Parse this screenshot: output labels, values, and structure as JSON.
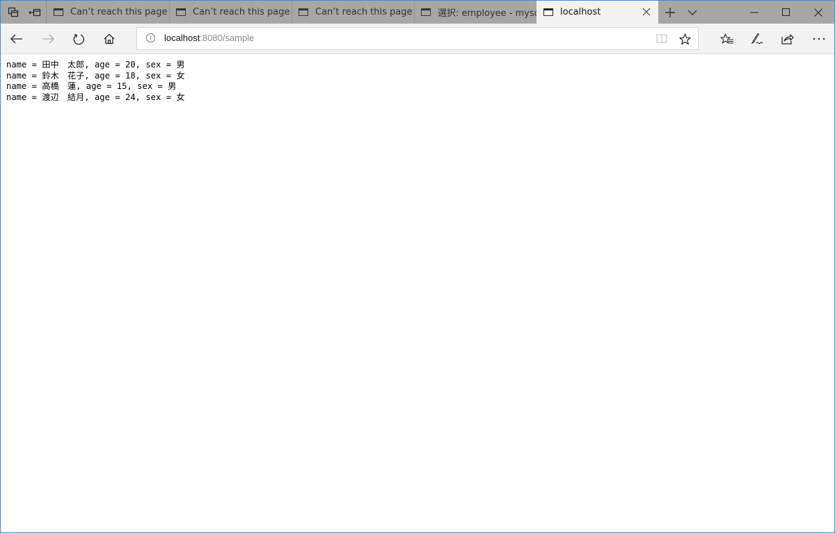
{
  "window": {
    "accent_border": "#3c8fd6",
    "tabbar_bg": "#a6a6a6",
    "active_tab_bg": "#f2f2f2"
  },
  "titlebar": {
    "set_aside_icon": "tabs-aside-icon",
    "restore_tabs_icon": "restore-tabs-icon",
    "new_tab_label": "+",
    "tab_list_label": "⌄",
    "minimize_label": "—",
    "maximize_label": "☐",
    "close_label": "✕"
  },
  "tabs": [
    {
      "title": "Can’t reach this page",
      "active": false
    },
    {
      "title": "Can’t reach this page",
      "active": false
    },
    {
      "title": "Can’t reach this page",
      "active": false
    },
    {
      "title": "選択: employee - mysq",
      "active": false
    },
    {
      "title": "localhost",
      "active": true,
      "close_label": "✕"
    }
  ],
  "navbar": {
    "back_label": "←",
    "forward_label": "→",
    "refresh_label": "↻",
    "home_label": "⌂",
    "address": {
      "info_label": "i",
      "host": "localhost",
      "rest": ":8080/sample"
    },
    "reading_view_label": "📖",
    "favorite_label": "☆",
    "favorites_hub_label": "☆≡",
    "notes_label": "✍",
    "share_label": "⇪",
    "more_label": "···"
  },
  "page": {
    "lines": [
      "name = 田中　太郎, age = 20, sex = 男",
      "name = 鈴木　花子, age = 18, sex = 女",
      "name = 高橋　蓮, age = 15, sex = 男",
      "name = 渡辺　結月, age = 24, sex = 女"
    ]
  }
}
